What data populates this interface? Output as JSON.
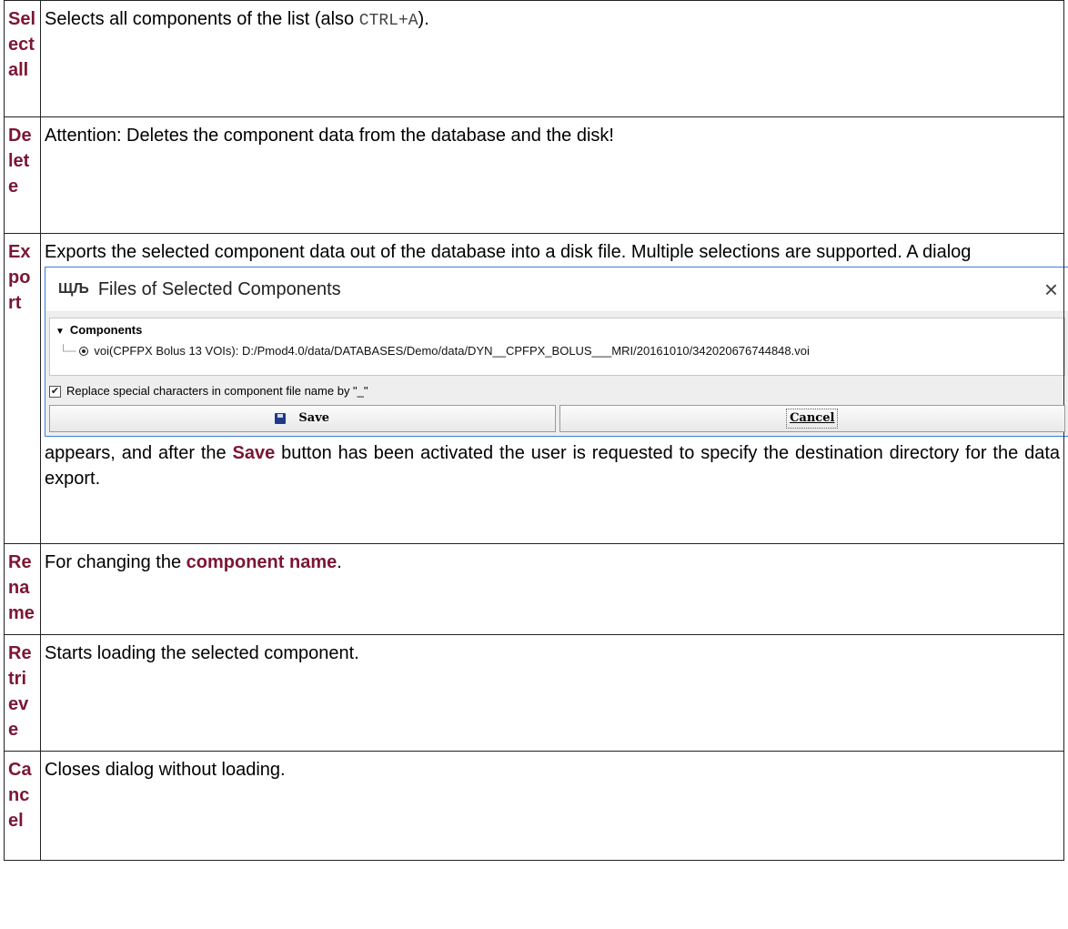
{
  "rows": [
    {
      "term": "Select all",
      "desc_before": "Selects all components of the list (also ",
      "desc_code": "CTRL+A",
      "desc_after": ")."
    },
    {
      "term": "Delete",
      "desc": "Attention: Deletes the component data from the database and the disk!"
    },
    {
      "term": "Export",
      "desc_intro": "Exports the selected component data out of the database into a disk file. Multiple selections are supported. A dialog",
      "desc_after_1": "appears, and after the ",
      "desc_highlight": "Save",
      "desc_after_2": " button has been activated the user is requested to specify the destination directory for the data export."
    },
    {
      "term": "Rename",
      "desc_before": "For changing the ",
      "desc_highlight": "component name",
      "desc_after": "."
    },
    {
      "term": "Retrieve",
      "desc": "Starts loading the selected component."
    },
    {
      "term": "Cancel",
      "desc": "Closes dialog without loading."
    }
  ],
  "dialog": {
    "title": "Files of Selected Components",
    "app_icon": "ЩЉ",
    "close_glyph": "×",
    "tree_root": "Components",
    "tree_leaf": "voi(CPFPX Bolus 13 VOIs): D:/Pmod4.0/data/DATABASES/Demo/data/DYN__CPFPX_BOLUS___MRI/20161010/342020676744848.voi",
    "checkbox_label": "Replace special characters in component file name by \"_\"",
    "checkbox_checked": true,
    "save_label": "Save",
    "cancel_label": "Cancel"
  },
  "colors": {
    "term": "#7b1634",
    "dialog_border": "#3d7fd6"
  }
}
